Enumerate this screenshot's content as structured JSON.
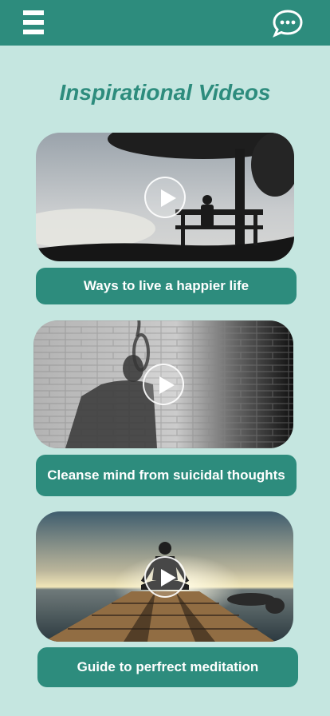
{
  "header": {
    "menu_icon": "hamburger-menu-icon",
    "chat_icon": "chat-bubble-icon",
    "bar_color": "#2d8c7d"
  },
  "page": {
    "title": "Inspirational Videos",
    "background": "#c5e6e0"
  },
  "videos": [
    {
      "label": "Ways to live a happier life",
      "thumbnail": "silhouette-on-park-bench"
    },
    {
      "label": "Cleanse mind from suicidal thoughts",
      "thumbnail": "shadow-against-brick-wall"
    },
    {
      "label": "Guide to perfrect meditation",
      "thumbnail": "meditation-on-pier-at-sunset"
    }
  ]
}
